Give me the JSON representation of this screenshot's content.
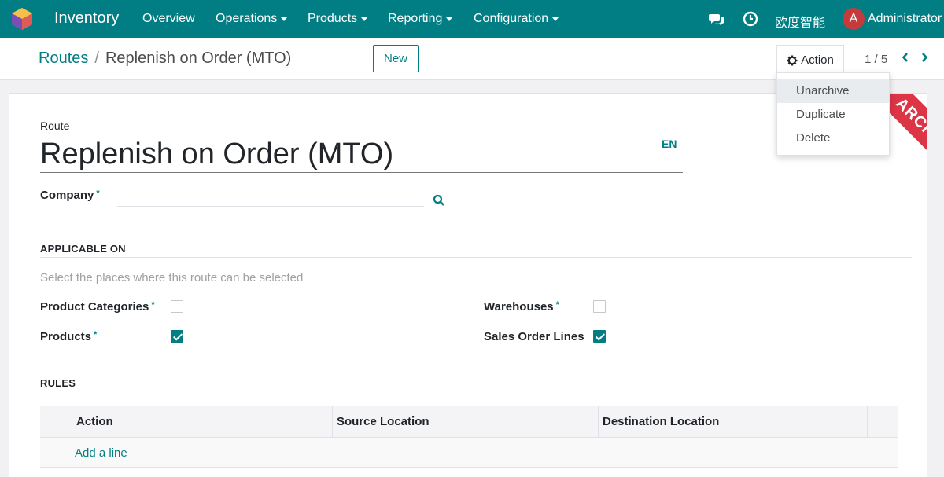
{
  "navbar": {
    "app_name": "Inventory",
    "menu": [
      "Overview",
      "Operations",
      "Products",
      "Reporting",
      "Configuration"
    ],
    "company": "欧度智能",
    "avatar_letter": "A",
    "user": "Administrator"
  },
  "breadcrumb": {
    "parent": "Routes",
    "separator": "/",
    "current": "Replenish on Order (MTO)"
  },
  "buttons": {
    "new": "New",
    "action": "Action"
  },
  "pager": "1 / 5",
  "action_menu": [
    "Unarchive",
    "Duplicate",
    "Delete"
  ],
  "ribbon": "ARCHIVED",
  "form": {
    "route_label": "Route",
    "route_name": "Replenish on Order (MTO)",
    "lang": "EN",
    "company_label": "Company",
    "required_mark": "*",
    "company_value": "",
    "applicable_title": "APPLICABLE ON",
    "applicable_help": "Select the places where this route can be selected",
    "product_categories_label": "Product Categories",
    "product_categories_checked": false,
    "products_label": "Products",
    "products_checked": true,
    "warehouses_label": "Warehouses",
    "warehouses_checked": false,
    "sales_order_lines_label": "Sales Order Lines",
    "sales_order_lines_checked": true,
    "rules_title": "RULES"
  },
  "rules_table": {
    "columns": [
      "Action",
      "Source Location",
      "Destination Location"
    ],
    "add_line": "Add a line"
  },
  "colors": {
    "brand": "#017e84",
    "ribbon": "#dc3545",
    "avatar": "#c53a3a"
  }
}
